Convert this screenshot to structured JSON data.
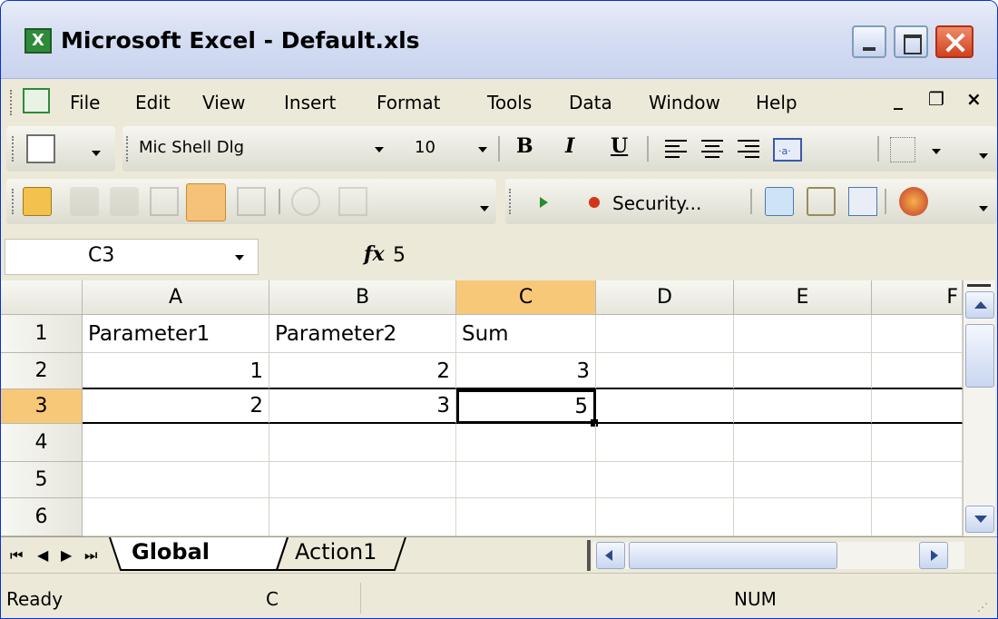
{
  "window": {
    "title": "Microsoft Excel - Default.xls"
  },
  "menu": {
    "items": [
      "File",
      "Edit",
      "View",
      "Insert",
      "Format",
      "Tools",
      "Data",
      "Window",
      "Help"
    ]
  },
  "format_toolbar": {
    "font_name": "Mic Shell Dlg",
    "font_size": "10",
    "bold_label": "B",
    "italic_label": "I",
    "underline_label": "U"
  },
  "review_toolbar": {
    "security_label": "Security..."
  },
  "formula_bar": {
    "name_box": "C3",
    "fx_label": "fx",
    "value": "5"
  },
  "sheet": {
    "columns": [
      "A",
      "B",
      "C",
      "D",
      "E",
      "F"
    ],
    "selected_column": "C",
    "rows": [
      "1",
      "2",
      "3",
      "4",
      "5",
      "6"
    ],
    "selected_row": "3",
    "cells": {
      "A1": "Parameter1",
      "B1": "Parameter2",
      "C1": "Sum",
      "A2": "1",
      "B2": "2",
      "C2": "3",
      "A3": "2",
      "B3": "3",
      "C3": "5"
    },
    "active_cell": "C3"
  },
  "tabs": [
    "Global",
    "Action1"
  ],
  "active_tab": "Global",
  "status": {
    "ready": "Ready",
    "mode_fragment": "C",
    "num": "NUM"
  }
}
